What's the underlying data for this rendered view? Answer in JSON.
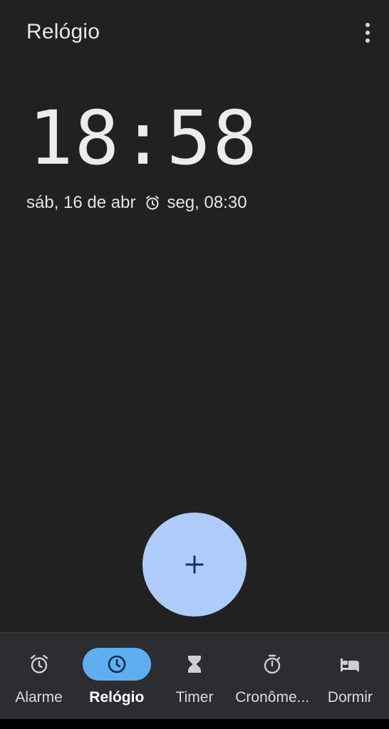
{
  "app": {
    "title": "Relógio"
  },
  "clock": {
    "time": "18:58",
    "date": "sáb, 16 de abr",
    "next_alarm": "seg, 08:30"
  },
  "fab": {
    "icon": "plus-icon"
  },
  "bottom_nav": {
    "items": [
      {
        "label": "Alarme",
        "icon": "alarm-icon",
        "active": false
      },
      {
        "label": "Relógio",
        "icon": "clock-icon",
        "active": true
      },
      {
        "label": "Timer",
        "icon": "hourglass-icon",
        "active": false
      },
      {
        "label": "Cronôme...",
        "icon": "stopwatch-icon",
        "active": false
      },
      {
        "label": "Dormir",
        "icon": "bed-icon",
        "active": false
      }
    ]
  },
  "colors": {
    "background": "#212121",
    "fab": "#aecbfa",
    "nav_active_pill": "#5faef0",
    "nav_background": "#2c2d31"
  }
}
